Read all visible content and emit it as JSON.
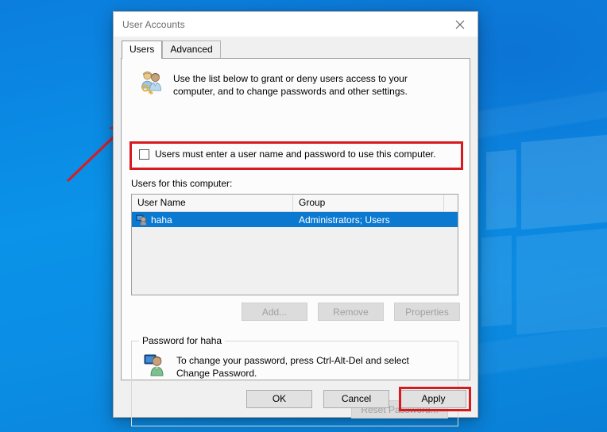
{
  "window": {
    "title": "User Accounts",
    "close_icon": "close-icon"
  },
  "tabs": [
    {
      "label": "Users",
      "active": true
    },
    {
      "label": "Advanced",
      "active": false
    }
  ],
  "users_tab": {
    "intro_icon": "two-users-with-key-icon",
    "intro_text": "Use the list below to grant or deny users access to your computer, and to change passwords and other settings.",
    "require_password_checkbox": {
      "label": "Users must enter a user name and password to use this computer.",
      "checked": false,
      "highlighted": true,
      "highlight_color": "#d71920"
    },
    "list_label": "Users for this computer:",
    "list": {
      "columns": [
        "User Name",
        "Group"
      ],
      "rows": [
        {
          "icon": "user-account-icon",
          "user_name": "haha",
          "group": "Administrators; Users",
          "selected": true
        }
      ],
      "selection_color": "#0b79d0"
    },
    "list_buttons": [
      {
        "label": "Add...",
        "disabled": true
      },
      {
        "label": "Remove",
        "disabled": true
      },
      {
        "label": "Properties",
        "disabled": true
      }
    ],
    "password_group": {
      "title": "Password for haha",
      "icon": "user-at-monitor-icon",
      "text": "To change your password, press Ctrl-Alt-Del and select Change Password.",
      "reset_button": {
        "label": "Reset Password...",
        "disabled": true
      }
    }
  },
  "dialog_buttons": [
    {
      "label": "OK",
      "disabled": false,
      "highlighted": false
    },
    {
      "label": "Cancel",
      "disabled": false,
      "highlighted": false
    },
    {
      "label": "Apply",
      "disabled": false,
      "highlighted": true
    }
  ],
  "annotations": {
    "arrow": {
      "name": "red-arrow-pointing-to-checkbox",
      "color": "#d32028"
    }
  },
  "desktop": {
    "wallpaper": "windows-10-blue-hero-wallpaper",
    "base_color": "#0a8ad8"
  }
}
